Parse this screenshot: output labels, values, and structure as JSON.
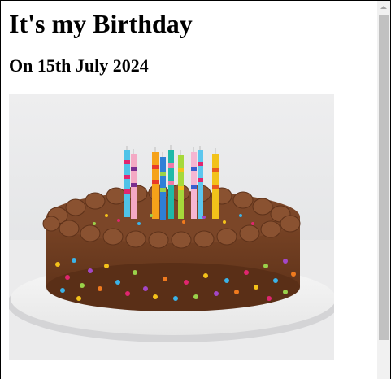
{
  "page": {
    "title": "It's my Birthday",
    "subtitle": "On 15th July 2024"
  },
  "image": {
    "alt": "Chocolate birthday cake with sprinkles and colorful candles",
    "icon": "cake-photo"
  },
  "colors": {
    "frosting": "#6b3a1f",
    "plate": "#ffffff",
    "background": "#e9e9ea",
    "scrollbar_track": "#f1f1f1",
    "scrollbar_thumb": "#c1c1c1"
  }
}
